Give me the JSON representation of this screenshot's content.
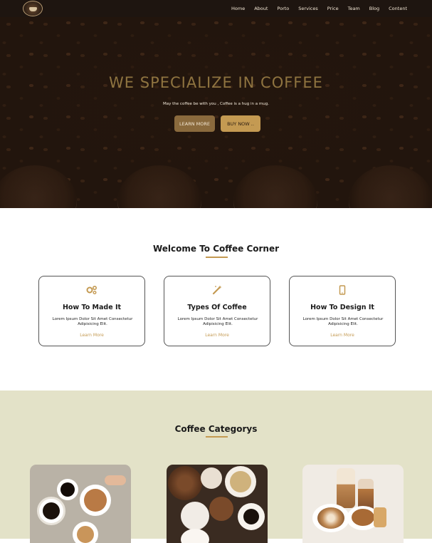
{
  "nav": {
    "links": [
      "Home",
      "About",
      "Porto",
      "Services",
      "Price",
      "Team",
      "Blog",
      "Content"
    ]
  },
  "hero": {
    "title": "WE SPECIALIZE IN COFFEE",
    "subtitle": "May the coffee be with you , Coffee is a hug in a mug.",
    "learn_more": "LEARN MORE",
    "buy_now": "BUY NOW ..",
    "accent": "#c49a52"
  },
  "welcome": {
    "title": "Welcome To Coffee Corner",
    "cards": [
      {
        "icon": "gears-icon",
        "title": "How To Made It",
        "text": "Lorem Ipsum Dolor Sit Amet Consectetur Adipisicing Elit.",
        "link": "Learn More"
      },
      {
        "icon": "magic-wand-icon",
        "title": "Types Of Coffee",
        "text": "Lorem Ipsum Dolor Sit Amet Consectetur Adipisicing Elit.",
        "link": "Learn More"
      },
      {
        "icon": "mobile-icon",
        "title": "How To Design It",
        "text": "Lorem Ipsum Dolor Sit Amet Consectetur Adipisicing Elit.",
        "link": "Learn More"
      }
    ]
  },
  "categories": {
    "title": "Coffee Categorys",
    "background": "#e3e2c8"
  }
}
